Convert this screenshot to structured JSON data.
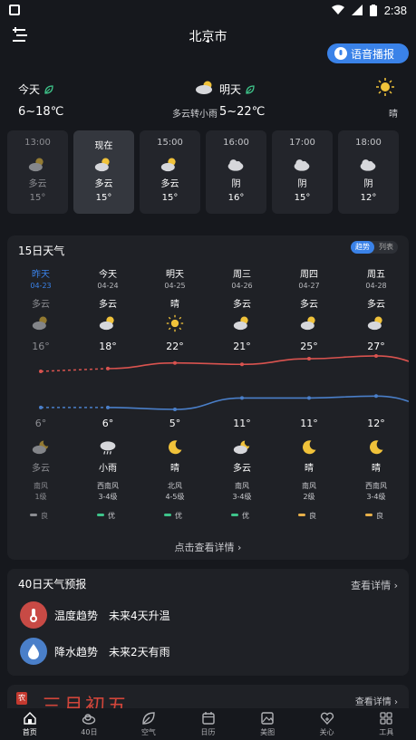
{
  "status_bar": {
    "time": "2:38"
  },
  "header": {
    "city": "北京市",
    "voice_button": "语音播报"
  },
  "today": {
    "label": "今天",
    "range": "6~18℃",
    "desc": "多云转小雨",
    "icon": "cloudy-icon"
  },
  "tomorrow": {
    "label": "明天",
    "range": "5~22℃",
    "desc": "晴",
    "icon": "sun-icon"
  },
  "hourly": [
    {
      "time": "13:00",
      "cond": "多云",
      "temp": "15°",
      "icon": "cloudy",
      "past": true,
      "now": false
    },
    {
      "time": "现在",
      "cond": "多云",
      "temp": "15°",
      "icon": "cloudy",
      "past": false,
      "now": true
    },
    {
      "time": "15:00",
      "cond": "多云",
      "temp": "15°",
      "icon": "cloudy",
      "past": false,
      "now": false
    },
    {
      "time": "16:00",
      "cond": "阴",
      "temp": "16°",
      "icon": "overcast",
      "past": false,
      "now": false
    },
    {
      "time": "17:00",
      "cond": "阴",
      "temp": "15°",
      "icon": "overcast",
      "past": false,
      "now": false
    },
    {
      "time": "18:00",
      "cond": "阴",
      "temp": "12°",
      "icon": "overcast",
      "past": false,
      "now": false
    }
  ],
  "forecast15": {
    "title": "15日天气",
    "toggle": [
      "趋势",
      "列表"
    ],
    "detail_link": "点击查看详情",
    "days": [
      {
        "name": "昨天",
        "date": "04-23",
        "day_cond": "多云",
        "day_icon": "cloudy",
        "high": 16,
        "low": 6,
        "night_icon": "cloudy-night",
        "night_cond": "多云",
        "wind_dir": "南风",
        "wind_lvl": "1级",
        "aqi": "良",
        "aqi_color": "#8c8d92",
        "past": true
      },
      {
        "name": "今天",
        "date": "04-24",
        "day_cond": "多云",
        "day_icon": "cloudy",
        "high": 18,
        "low": 6,
        "night_icon": "rain",
        "night_cond": "小雨",
        "wind_dir": "西南风",
        "wind_lvl": "3-4级",
        "aqi": "优",
        "aqi_color": "#3ec48a",
        "past": false
      },
      {
        "name": "明天",
        "date": "04-25",
        "day_cond": "晴",
        "day_icon": "sun",
        "high": 22,
        "low": 5,
        "night_icon": "moon",
        "night_cond": "晴",
        "wind_dir": "北风",
        "wind_lvl": "4-5级",
        "aqi": "优",
        "aqi_color": "#3ec48a",
        "past": false
      },
      {
        "name": "周三",
        "date": "04-26",
        "day_cond": "多云",
        "day_icon": "cloudy",
        "high": 21,
        "low": 11,
        "night_icon": "cloudy-night",
        "night_cond": "多云",
        "wind_dir": "南风",
        "wind_lvl": "3-4级",
        "aqi": "优",
        "aqi_color": "#3ec48a",
        "past": false
      },
      {
        "name": "周四",
        "date": "04-27",
        "day_cond": "多云",
        "day_icon": "cloudy",
        "high": 25,
        "low": 11,
        "night_icon": "moon",
        "night_cond": "晴",
        "wind_dir": "南风",
        "wind_lvl": "2级",
        "aqi": "良",
        "aqi_color": "#e8b04a",
        "past": false
      },
      {
        "name": "周五",
        "date": "04-28",
        "day_cond": "多云",
        "day_icon": "cloudy",
        "high": 27,
        "low": 12,
        "night_icon": "moon",
        "night_cond": "晴",
        "wind_dir": "西南风",
        "wind_lvl": "3-4级",
        "aqi": "良",
        "aqi_color": "#e8b04a",
        "past": false
      }
    ]
  },
  "forecast40": {
    "title": "40日天气预报",
    "more": "查看详情",
    "temp_label": "温度趋势",
    "temp_value": "未来4天升温",
    "rain_label": "降水趋势",
    "rain_value": "未来2天有雨"
  },
  "almanac": {
    "badge": "农",
    "date": "三月初五",
    "more": "查看详情"
  },
  "nav": [
    {
      "label": "首页",
      "icon": "home-icon",
      "active": true
    },
    {
      "label": "40日",
      "icon": "cloud-icon",
      "active": false
    },
    {
      "label": "空气",
      "icon": "leaf-icon",
      "active": false
    },
    {
      "label": "日历",
      "icon": "calendar-icon",
      "active": false
    },
    {
      "label": "美图",
      "icon": "image-icon",
      "active": false
    },
    {
      "label": "关心",
      "icon": "heart-icon",
      "active": false
    },
    {
      "label": "工具",
      "icon": "tools-icon",
      "active": false
    }
  ],
  "colors": {
    "high_line": "#d9534f",
    "low_line": "#4a7fc9",
    "accent": "#3a82e8",
    "sun": "#f0c23a"
  }
}
